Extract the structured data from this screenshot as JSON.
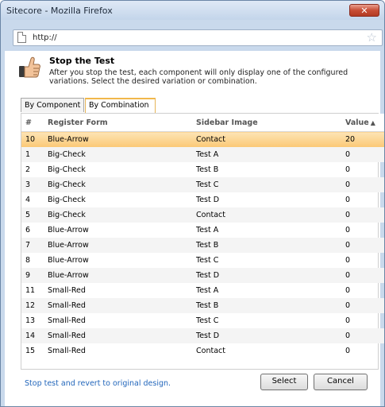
{
  "window": {
    "title": "Sitecore - Mozilla Firefox",
    "close_glyph": "✕"
  },
  "urlbar": {
    "url": "http://",
    "star_glyph": "☆"
  },
  "header": {
    "title": "Stop the Test",
    "description": "After you stop the test, each component will only display one of the configured variations. Select the desired variation or combination."
  },
  "tabs": [
    {
      "label": "By Component",
      "active": false
    },
    {
      "label": "By Combination",
      "active": true
    }
  ],
  "table": {
    "columns": [
      "#",
      "Register Form",
      "Sidebar Image",
      "Value"
    ],
    "sort_indicator": "▲",
    "rows": [
      {
        "num": "10",
        "register": "Blue-Arrow",
        "sidebar": "Contact",
        "value": "20"
      },
      {
        "num": "1",
        "register": "Big-Check",
        "sidebar": "Test A",
        "value": "0"
      },
      {
        "num": "2",
        "register": "Big-Check",
        "sidebar": "Test B",
        "value": "0"
      },
      {
        "num": "3",
        "register": "Big-Check",
        "sidebar": "Test C",
        "value": "0"
      },
      {
        "num": "4",
        "register": "Big-Check",
        "sidebar": "Test D",
        "value": "0"
      },
      {
        "num": "5",
        "register": "Big-Check",
        "sidebar": "Contact",
        "value": "0"
      },
      {
        "num": "6",
        "register": "Blue-Arrow",
        "sidebar": "Test A",
        "value": "0"
      },
      {
        "num": "7",
        "register": "Blue-Arrow",
        "sidebar": "Test B",
        "value": "0"
      },
      {
        "num": "8",
        "register": "Blue-Arrow",
        "sidebar": "Test C",
        "value": "0"
      },
      {
        "num": "9",
        "register": "Blue-Arrow",
        "sidebar": "Test D",
        "value": "0"
      },
      {
        "num": "11",
        "register": "Small-Red",
        "sidebar": "Test A",
        "value": "0"
      },
      {
        "num": "12",
        "register": "Small-Red",
        "sidebar": "Test B",
        "value": "0"
      },
      {
        "num": "13",
        "register": "Small-Red",
        "sidebar": "Test C",
        "value": "0"
      },
      {
        "num": "14",
        "register": "Small-Red",
        "sidebar": "Test D",
        "value": "0"
      },
      {
        "num": "15",
        "register": "Small-Red",
        "sidebar": "Contact",
        "value": "0"
      }
    ]
  },
  "footer": {
    "link_text": "Stop test and revert to original design.",
    "select_label": "Select",
    "cancel_label": "Cancel"
  },
  "colors": {
    "selected_row": "#fbc875",
    "link": "#2266bb",
    "active_tab": "#f1b84b"
  }
}
